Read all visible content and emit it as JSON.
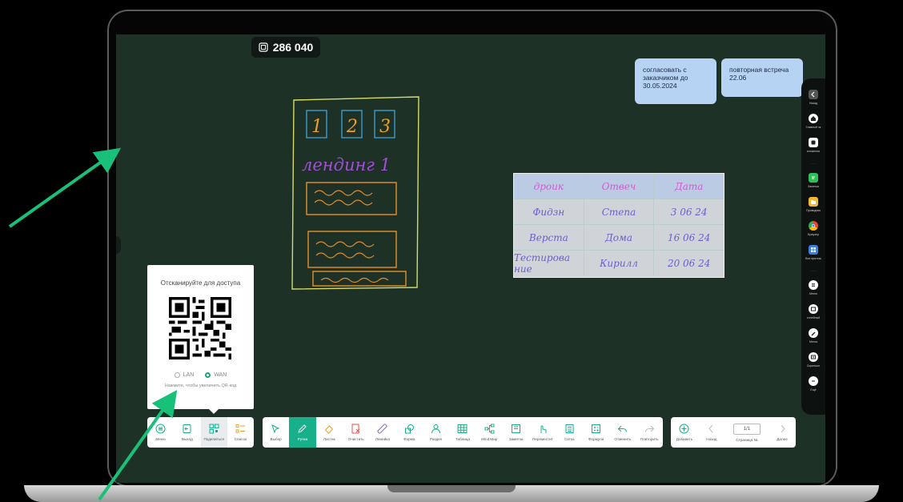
{
  "board": {
    "counter_value": "286 040",
    "sticky_notes": [
      "согласовать с заказчиком до 30.05.2024",
      "повторная встреча 22.06"
    ],
    "table": {
      "header": [
        "дроuк",
        "Отвеч",
        "Дата"
      ],
      "rows": [
        [
          "Фидзн",
          "Степа",
          "3 06 24"
        ],
        [
          "Верста",
          "Дома",
          "16 06 24"
        ],
        [
          "Тестирова ние",
          "Кирилл",
          "20 06 24"
        ]
      ]
    },
    "drawing": {
      "digits": [
        "1",
        "2",
        "3"
      ],
      "heading": "лендинг 1"
    }
  },
  "share_panel": {
    "title": "Отсканируйте для доступа",
    "options": [
      {
        "label": "LAN",
        "selected": false
      },
      {
        "label": "WAN",
        "selected": true
      }
    ],
    "hint": "Нажмите, чтобы увеличить QR-код"
  },
  "toolbar_left": [
    {
      "label": "Меню",
      "icon": "menu-icon"
    },
    {
      "label": "Выход",
      "icon": "exit-icon"
    },
    {
      "label": "Поделиться",
      "icon": "share-icon",
      "state": "soft"
    },
    {
      "label": "Список",
      "icon": "list-icon"
    }
  ],
  "toolbar_main": [
    {
      "label": "Выбор",
      "icon": "select-icon"
    },
    {
      "label": "Ручка",
      "icon": "pen-icon",
      "state": "active"
    },
    {
      "label": "Ластик",
      "icon": "eraser-icon"
    },
    {
      "label": "Очистить",
      "icon": "clear-icon"
    },
    {
      "label": "Линейка",
      "icon": "ruler-icon"
    },
    {
      "label": "Форма",
      "icon": "shape-icon"
    },
    {
      "label": "Раздел",
      "icon": "split-icon"
    },
    {
      "label": "Таблица",
      "icon": "table-icon"
    },
    {
      "label": "Mind Map",
      "icon": "mind-map-icon"
    },
    {
      "label": "Заметки",
      "icon": "notes-icon"
    },
    {
      "label": "Переместит",
      "icon": "move-icon"
    },
    {
      "label": "Сетка",
      "icon": "grid-icon"
    },
    {
      "label": "Формула",
      "icon": "formula-icon"
    },
    {
      "label": "Отменить",
      "icon": "undo-icon"
    },
    {
      "label": "Повторить",
      "icon": "redo-icon"
    }
  ],
  "toolbar_pages": {
    "add_label": "Добавить",
    "back_label": "Назад",
    "page_value": "1/1",
    "page_label": "Страница №",
    "next_label": "Далее"
  },
  "sidebar": [
    {
      "label": "Назад",
      "icon": "back-icon"
    },
    {
      "label": "Главный эк",
      "icon": "home-icon"
    },
    {
      "label": "иложения",
      "icon": "apps-icon"
    },
    {
      "label": "Заметки",
      "icon": "notes-app-icon"
    },
    {
      "label": "Проводник",
      "icon": "folder-icon"
    },
    {
      "label": "Браузер",
      "icon": "browser-icon"
    },
    {
      "label": "Все прилож",
      "icon": "all-apps-icon"
    },
    {
      "label": "Меню",
      "icon": "menu-icon"
    },
    {
      "label": "сплейный",
      "icon": "display-icon"
    },
    {
      "label": "Метка",
      "icon": "marker-icon"
    },
    {
      "label": "Скриншот",
      "icon": "screenshot-icon"
    },
    {
      "label": "Ещё",
      "icon": "more-icon"
    }
  ],
  "colors": {
    "board": "#1d3127",
    "accent": "#17b08b",
    "sticky": "#b7d3f3",
    "arrow": "#19c07a"
  }
}
